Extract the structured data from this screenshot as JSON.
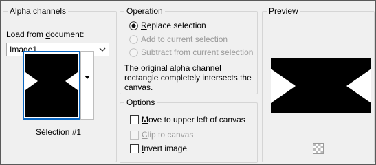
{
  "alpha_channels": {
    "title": "Alpha channels",
    "load_label_pre": "Load from ",
    "load_label_accel": "d",
    "load_label_post": "ocument:",
    "document_value": "Image1",
    "selection_name": "Sélection #1"
  },
  "operation": {
    "title": "Operation",
    "options": [
      {
        "accel": "R",
        "rest": "eplace selection",
        "selected": true,
        "enabled": true
      },
      {
        "accel": "A",
        "rest": "dd to current selection",
        "selected": false,
        "enabled": false
      },
      {
        "accel": "S",
        "rest": "ubtract from current selection",
        "selected": false,
        "enabled": false
      }
    ],
    "description": "The original alpha channel rectangle completely intersects the canvas."
  },
  "options": {
    "title": "Options",
    "items": [
      {
        "accel": "M",
        "rest": "ove to upper left of canvas",
        "checked": false,
        "enabled": true
      },
      {
        "accel": "C",
        "rest": "lip to canvas",
        "checked": false,
        "enabled": false
      },
      {
        "accel": "I",
        "rest": "nvert image",
        "checked": false,
        "enabled": true
      }
    ]
  },
  "preview": {
    "title": "Preview"
  },
  "colors": {
    "selection_border": "#0a67c3",
    "disabled_text": "#9a9a9a"
  }
}
